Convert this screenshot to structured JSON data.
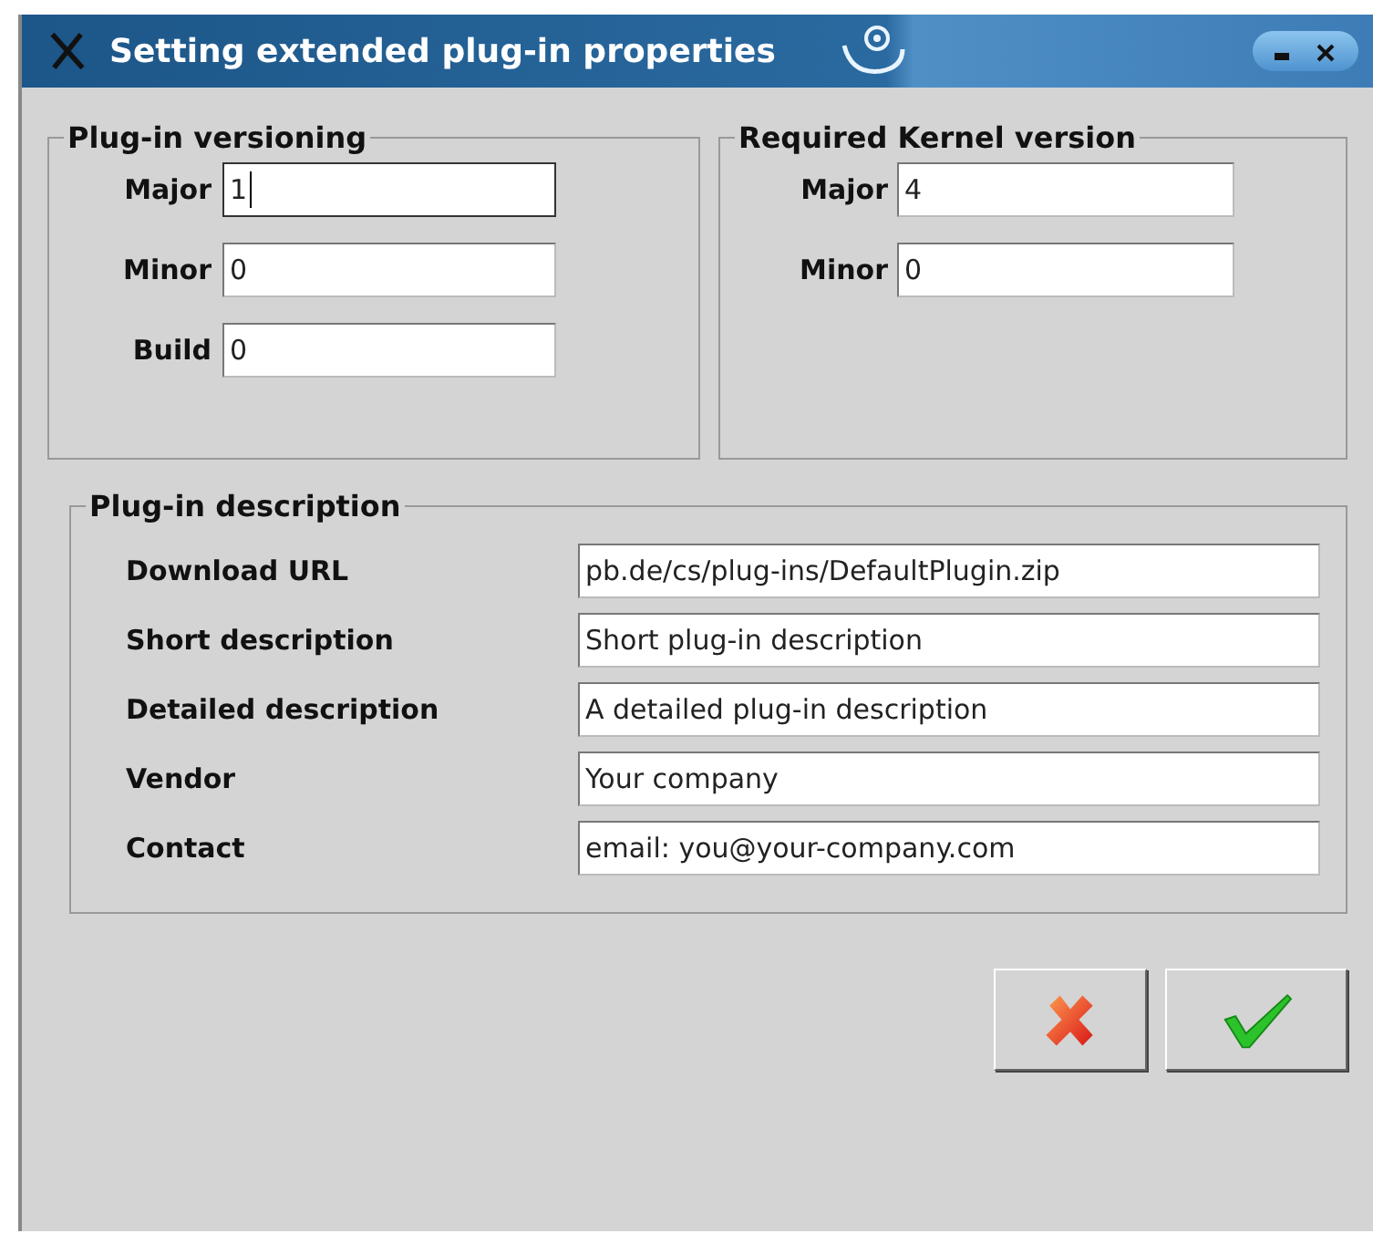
{
  "window": {
    "title": "Setting extended plug-in properties"
  },
  "groups": [
    {
      "title": "Plug-in versioning",
      "fields": [
        {
          "label": "Major",
          "value": "1",
          "focused": true
        },
        {
          "label": "Minor",
          "value": "0",
          "focused": false
        },
        {
          "label": "Build",
          "value": "0",
          "focused": false
        }
      ]
    },
    {
      "title": "Required Kernel version",
      "fields": [
        {
          "label": "Major",
          "value": "4",
          "focused": false
        },
        {
          "label": "Minor",
          "value": "0",
          "focused": false
        }
      ]
    }
  ],
  "description": {
    "title": "Plug-in description",
    "fields": [
      {
        "label": "Download URL",
        "value": "pb.de/cs/plug-ins/DefaultPlugin.zip"
      },
      {
        "label": "Short description",
        "value": "Short plug-in description"
      },
      {
        "label": "Detailed description",
        "value": "A detailed plug-in description"
      },
      {
        "label": "Vendor",
        "value": "Your company"
      },
      {
        "label": "Contact",
        "value": "email: you@your-company.com"
      }
    ]
  },
  "buttons": [
    {
      "kind": "cancel"
    },
    {
      "kind": "ok"
    }
  ]
}
